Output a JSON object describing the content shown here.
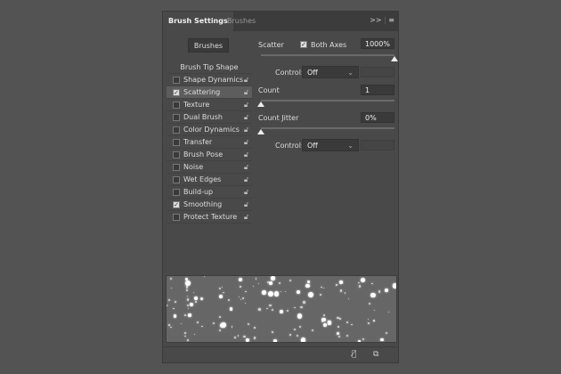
{
  "tabs": [
    {
      "label": "Brush Settings",
      "active": true
    },
    {
      "label": "Brushes",
      "active": false
    }
  ],
  "menu_icons": {
    "expand": ">>",
    "menu": "≡"
  },
  "brushes_button": "Brushes",
  "list": {
    "header": "Brush Tip Shape",
    "items": [
      {
        "label": "Shape Dynamics",
        "checked": false
      },
      {
        "label": "Scattering",
        "checked": true,
        "selected": true
      },
      {
        "label": "Texture",
        "checked": false
      },
      {
        "label": "Dual Brush",
        "checked": false
      },
      {
        "label": "Color Dynamics",
        "checked": false
      },
      {
        "label": "Transfer",
        "checked": false
      },
      {
        "label": "Brush Pose",
        "checked": false
      },
      {
        "label": "Noise",
        "checked": false
      },
      {
        "label": "Wet Edges",
        "checked": false
      },
      {
        "label": "Build-up",
        "checked": false
      },
      {
        "label": "Smoothing",
        "checked": true
      },
      {
        "label": "Protect Texture",
        "checked": false
      }
    ]
  },
  "scatter": {
    "label": "Scatter",
    "both_axes_label": "Both Axes",
    "both_axes": true,
    "value": "1000%",
    "slider": 1.0,
    "control_label": "Control:",
    "control": "Off"
  },
  "count": {
    "label": "Count",
    "value": "1",
    "slider": 0.0
  },
  "count_jitter": {
    "label": "Count Jitter",
    "value": "0%",
    "slider": 0.0,
    "control_label": "Control:",
    "control": "Off"
  },
  "colors": {
    "panel": "#494949",
    "tabbar": "#3c3c3c",
    "preview": "#666666"
  }
}
